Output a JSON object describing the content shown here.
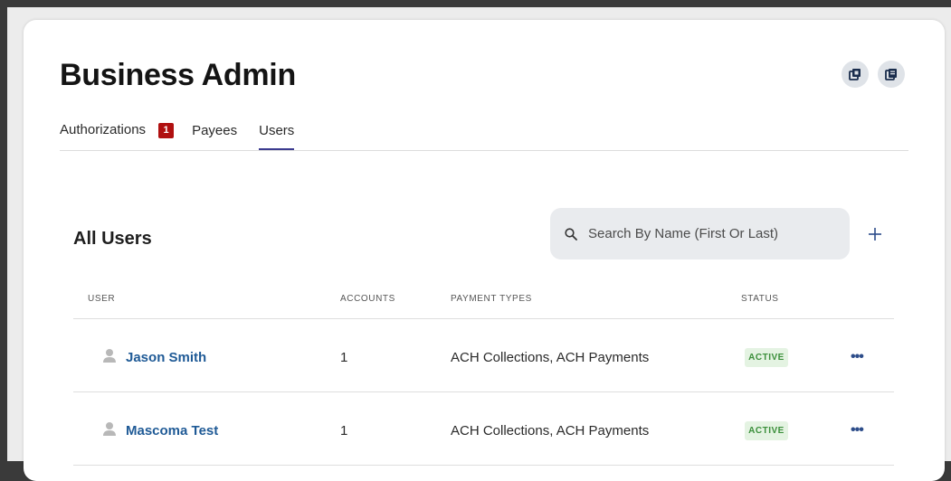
{
  "page": {
    "title": "Business Admin"
  },
  "tabs": [
    {
      "label": "Authorizations",
      "badge": "1"
    },
    {
      "label": "Payees"
    },
    {
      "label": "Users",
      "active": true
    }
  ],
  "section": {
    "title": "All Users"
  },
  "search": {
    "placeholder": "Search By Name (First Or Last)",
    "icon": "search-icon"
  },
  "add_icon": "plus-icon",
  "table": {
    "columns": [
      "USER",
      "ACCOUNTS",
      "PAYMENT TYPES",
      "STATUS"
    ],
    "rows": [
      {
        "user": "Jason Smith",
        "accounts": "1",
        "payment_types": "ACH Collections, ACH Payments",
        "status": "ACTIVE",
        "more": "•••"
      },
      {
        "user": "Mascoma Test",
        "accounts": "1",
        "payment_types": "ACH Collections, ACH Payments",
        "status": "ACTIVE",
        "more": "•••"
      }
    ]
  },
  "colors": {
    "accent": "#3b3a8f",
    "link": "#1f5a96",
    "badge": "#b01010",
    "status_bg": "#e4f3e2",
    "status_text": "#3b8f3b"
  }
}
